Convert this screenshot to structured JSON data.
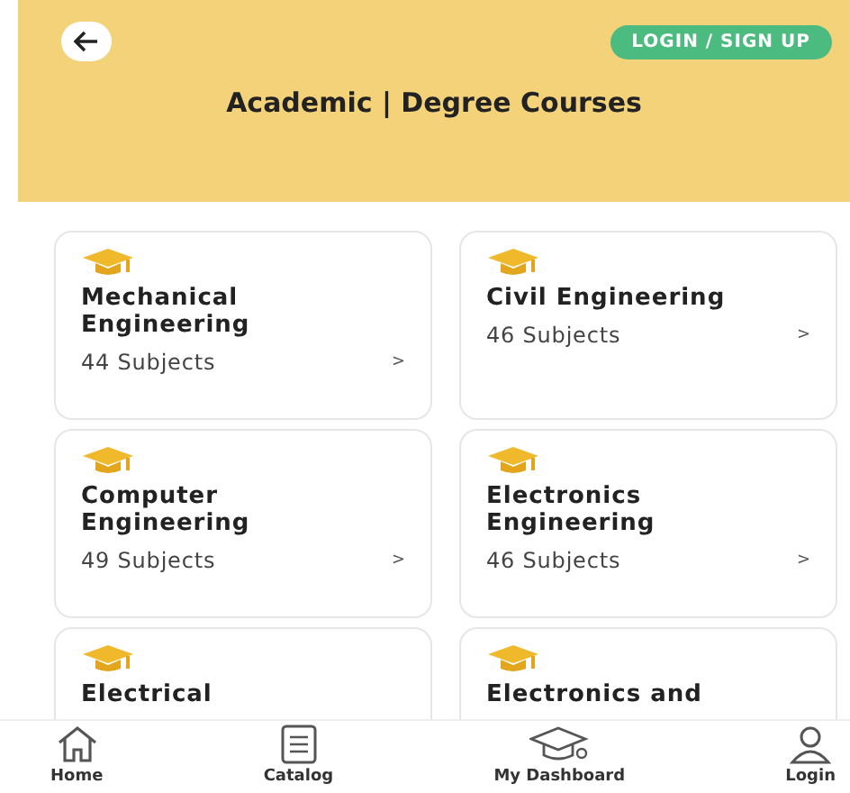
{
  "header": {
    "login_button": "LOGIN / SIGN UP",
    "title": "Academic | Degree Courses"
  },
  "courses": [
    {
      "title": "Mechanical Engineering",
      "subjects": "44 Subjects",
      "chevron": ">"
    },
    {
      "title": "Civil Engineering",
      "subjects": "46 Subjects",
      "chevron": ">"
    },
    {
      "title": "Computer Engineering",
      "subjects": "49 Subjects",
      "chevron": ">"
    },
    {
      "title": "Electronics Engineering",
      "subjects": "46 Subjects",
      "chevron": ">"
    },
    {
      "title": "Electrical"
    },
    {
      "title": "Electronics and"
    }
  ],
  "bottom_nav": [
    {
      "label": "Home",
      "kind": "home"
    },
    {
      "label": "Catalog",
      "kind": "catalog"
    },
    {
      "label": "My Dashboard",
      "kind": "dashboard"
    },
    {
      "label": "Login",
      "kind": "login"
    }
  ]
}
